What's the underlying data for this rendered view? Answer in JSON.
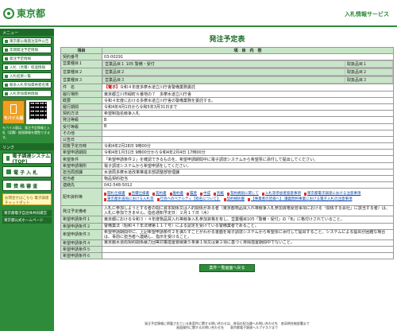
{
  "header": {
    "logo": "東京都",
    "service": "入札情報サービス"
  },
  "sidebar": {
    "menu_head": "メニュー",
    "items": [
      {
        "label": "東京都公報発注案件公告"
      },
      {
        "label": "年間発注予定情報"
      },
      {
        "label": "発注予定情報"
      },
      {
        "label": "入札（見積）経過情報"
      },
      {
        "label": "入札結果一覧"
      },
      {
        "label": "競争入札参加資格者名簿"
      },
      {
        "label": "入札参加資格情報"
      }
    ],
    "mobile_label": "モバイル版",
    "mobile_note": "モバイル版は、発注予定情報と入札（見積）経過情報を閲覧できます。",
    "links_head": "リンク",
    "big_buttons": [
      {
        "label": "電子調達システム(TOP)"
      },
      {
        "label": "電 子 入 札"
      },
      {
        "label": "資 格 審 査"
      }
    ],
    "chatbot": "お問合せはこちら 電子調達チャットボット",
    "bottom_links": [
      {
        "label": "東京都電子自治体共同運営"
      },
      {
        "label": "東京都公式ホームページ"
      }
    ]
  },
  "main": {
    "title": "発注予定表",
    "col_item": "項目",
    "col_content": "項　目　内　容",
    "rows": [
      {
        "key": "契約番号",
        "value": "03-00291"
      },
      {
        "key": "件　名",
        "badge": "【電子】",
        "value": "令和４年度多摩水道立川庁舎警備業務委託"
      },
      {
        "key": "履行場所",
        "value": "東京都立川市緑町６番地の７　多摩水道立川庁舎"
      },
      {
        "key": "概要",
        "value": "令和４年度における多摩水道立川庁舎の警備業務を委託する。"
      },
      {
        "key": "履行期間",
        "value": "令和4年4月1日から令和5年3月31日まで"
      },
      {
        "key": "契約方法",
        "value": "希望制指名競争入札"
      },
      {
        "key": "発注等級",
        "value": "B"
      },
      {
        "key": "受付等級",
        "value": "B"
      },
      {
        "key": "その他",
        "value": ""
      },
      {
        "key": "公告日",
        "value": ""
      },
      {
        "key": "閲覧予定日時",
        "value": "令和4年2月28日 9時00分"
      },
      {
        "key": "希望申請期間",
        "value": "令和4年1月31日 9時00分から令和4年2月4日 17時00分"
      },
      {
        "key": "希望条件",
        "value": "「希望申請条件２」を確認できるものを、希望申請期間中に電子調達システムから希望票に添付して提出してください。"
      },
      {
        "key": "希望申請場所",
        "value": "電子調達システムから希望申請をしてください。"
      },
      {
        "key": "担当局部課",
        "value": "水道局多摩水道改革推進本部調整部管理課"
      },
      {
        "key": "担当者",
        "value": "物品契約担当"
      },
      {
        "key": "連絡先",
        "value": "042-548-5012"
      }
    ],
    "business_rows": [
      {
        "key": "営業種目１",
        "v1": "営業品目１ 105 警備・受付",
        "v2": "取扱品目１"
      },
      {
        "key": "営業種目２",
        "v1": "営業品目２",
        "v2": "取扱品目２"
      },
      {
        "key": "営業種目３",
        "v1": "営業品目３",
        "v2": "取扱品目３"
      }
    ],
    "files_label": "配布資料等",
    "files": [
      "開札仕様書",
      "見積仕様書",
      "契約書",
      "誓約書",
      "履歴",
      "中成",
      "別紙",
      "契約規則に関して",
      "入札等参加者留意事項",
      "東京都電子調達における注意事項",
      "東京都水道局における入札等",
      "行為ヘのペナルティ【指名について】",
      "契約規則書",
      "【事業者の皆様へ】 講義問約事業における電子入札の注意事項"
    ],
    "note_label": "発注予定備考",
    "note": "入札に参加しようとする者の間に資本関係又は人的関係がある者（東京都物品買入れ等競争入札参加資格受容事項における「関係する会社」に該当する者）は、入札に参加できません。指名通知予定日：２月１７日（木）",
    "conditions": [
      {
        "key": "希望申請条件１",
        "value": "東京都における令和３・４年度物品買入れ等競争入札参加資格を有し、営業種目105「警備・受付」の「B」に格付けされていること。"
      },
      {
        "key": "希望申請条件２",
        "value": "警備業法（昭和４７年法律第１１７号）による認定を受けている警備業者であること。"
      },
      {
        "key": "希望申請条件３",
        "value": "希望申請期間中に、上記希望申請条件２を満たすことがわかる書面を電子調達システムから希望票に添付して提出すること。システムによる提出が困難な場合は、事前に担当者へ連絡し、指示を受けること。"
      },
      {
        "key": "希望申請条件４",
        "value": "東京都水道局契約関係暴力団等対策措置要綱第５条第１項又は第２項に基づく排除措置期間中でないこと。"
      },
      {
        "key": "希望申請条件５",
        "value": ""
      },
      {
        "key": "希望申請条件６",
        "value": ""
      }
    ],
    "back_button": "案件一覧画面へ戻る"
  },
  "footer": {
    "line1": "発注予定情報に掲載されている各案件に関する問い合わせは、各局の担当課へお問い合わせ先　各局問合総部署まで",
    "line2": "画面操作に関するお問い合わせ先　　東京都電子調達ヘルプデスクまで"
  }
}
